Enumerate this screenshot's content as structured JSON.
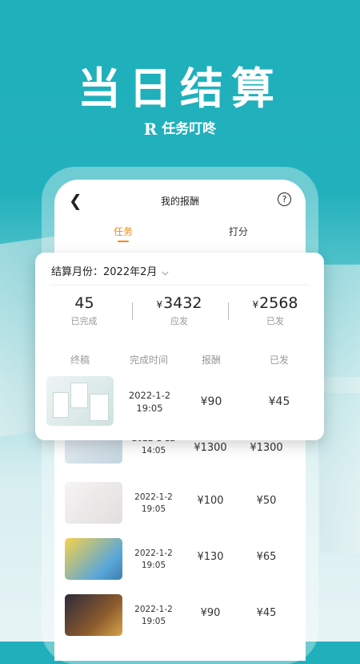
{
  "hero": {
    "title": "当日结算",
    "brand_logo": "R",
    "brand_name": "任务叮咚"
  },
  "nav": {
    "title": "我的报酬",
    "back_icon": "chevron-left-icon",
    "help_icon": "question-circle-icon"
  },
  "tabs": [
    {
      "label": "任务",
      "active": true
    },
    {
      "label": "打分",
      "active": false
    }
  ],
  "summary": {
    "month_label": "结算月份：",
    "month_value": "2022年2月",
    "stats": [
      {
        "value": "45",
        "label": "已完成",
        "currency": ""
      },
      {
        "value": "3432",
        "label": "应发",
        "currency": "¥"
      },
      {
        "value": "2568",
        "label": "已发",
        "currency": "¥"
      }
    ],
    "headers": [
      "终稿",
      "完成时间",
      "报酬",
      "已发"
    ],
    "first_row": {
      "date": "2022-1-2",
      "time": "19:05",
      "pay": "¥90",
      "paid": "¥45"
    }
  },
  "rows": [
    {
      "date": "2022-1-12",
      "time": "14:05",
      "pay": "¥1300",
      "paid": "¥1300",
      "thumb_color": "#dfe8ee"
    },
    {
      "date": "2022-1-2",
      "time": "19:05",
      "pay": "¥100",
      "paid": "¥50",
      "thumb_color": "#f0eeee"
    },
    {
      "date": "2022-1-2",
      "time": "19:05",
      "pay": "¥130",
      "paid": "¥65",
      "thumb_color": "#f3c53b"
    },
    {
      "date": "2022-1-2",
      "time": "19:05",
      "pay": "¥90",
      "paid": "¥45",
      "thumb_color": "#3a3445"
    }
  ],
  "colors": {
    "accent": "#f28a16",
    "background": "#21afbb"
  }
}
